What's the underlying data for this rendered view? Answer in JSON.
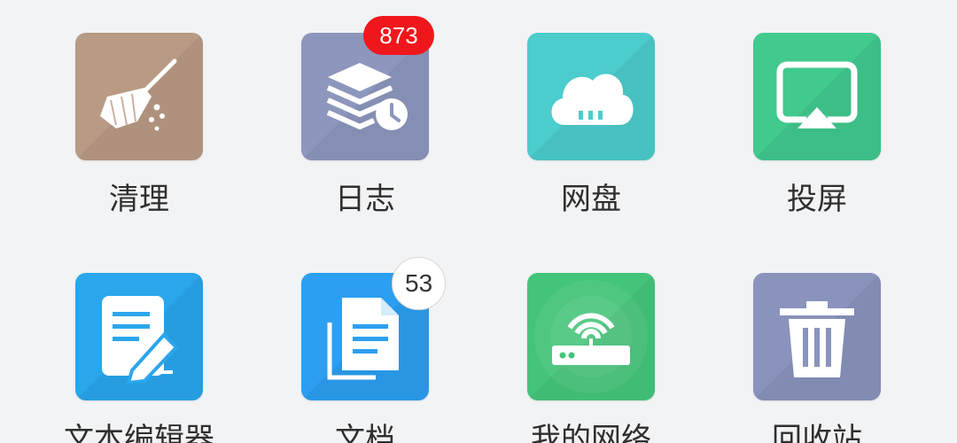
{
  "apps": [
    {
      "label": "清理",
      "icon": "broom-icon",
      "color": "#b99a84"
    },
    {
      "label": "日志",
      "icon": "stack-clock-icon",
      "color": "#8d96bd",
      "badge": "873",
      "badge_color": "#f0171c"
    },
    {
      "label": "网盘",
      "icon": "cloud-icon",
      "color": "#4ccccc"
    },
    {
      "label": "投屏",
      "icon": "screen-cast-icon",
      "color": "#41c98e"
    },
    {
      "label": "文本编辑器",
      "icon": "document-pen-icon",
      "color": "#2aa6ec"
    },
    {
      "label": "文档",
      "icon": "documents-icon",
      "color": "#2c9ff0",
      "badge": "53",
      "badge_color": "#ffffff"
    },
    {
      "label": "我的网络",
      "icon": "router-icon",
      "color": "#44c47a"
    },
    {
      "label": "回收站",
      "icon": "trash-icon",
      "color": "#8a93bc"
    }
  ]
}
